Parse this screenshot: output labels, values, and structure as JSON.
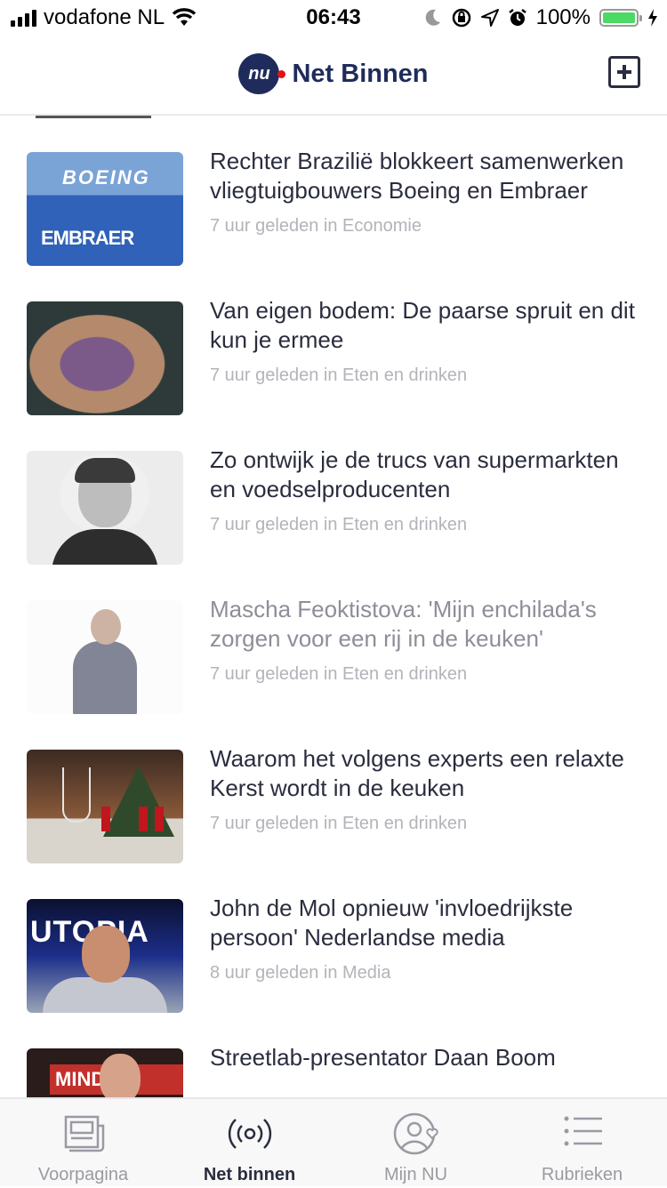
{
  "status_bar": {
    "carrier": "vodafone NL",
    "time": "06:43",
    "battery": "100%",
    "battery_level": 1.0
  },
  "header": {
    "logo_text": "nu",
    "title": "Net Binnen",
    "add_icon": "add-square-icon"
  },
  "articles": [
    {
      "title": "Rechter Brazilië blokkeert samenwerken vliegtuigbouwers Boeing en Embraer",
      "meta": "7 uur geleden in Economie",
      "read": false,
      "thumb_text_1": "BOEING",
      "thumb_text_2": "EMBRAER"
    },
    {
      "title": "Van eigen bodem: De paarse spruit en dit kun je ermee",
      "meta": "7 uur geleden in Eten en drinken",
      "read": false
    },
    {
      "title": "Zo ontwijk je de trucs van supermarkten en voedselproducenten",
      "meta": "7 uur geleden in Eten en drinken",
      "read": false
    },
    {
      "title": "Mascha Feoktistova: 'Mijn enchilada's zorgen voor een rij in de keuken'",
      "meta": "7 uur geleden in Eten en drinken",
      "read": true
    },
    {
      "title": "Waarom het volgens experts een relaxte Kerst wordt in de keuken",
      "meta": "7 uur geleden in Eten en drinken",
      "read": false
    },
    {
      "title": "John de Mol opnieuw 'invloedrijkste persoon' Nederlandse media",
      "meta": "8 uur geleden in Media",
      "read": false,
      "thumb_text_1": "UTOPIA"
    },
    {
      "title": "Streetlab-presentator Daan Boom ",
      "meta": "",
      "read": false,
      "thumb_text_1": "MINDF"
    }
  ],
  "tabs": [
    {
      "label": "Voorpagina",
      "icon": "newspaper-icon",
      "active": false
    },
    {
      "label": "Net binnen",
      "icon": "broadcast-icon",
      "active": true
    },
    {
      "label": "Mijn NU",
      "icon": "user-heart-icon",
      "active": false
    },
    {
      "label": "Rubrieken",
      "icon": "list-icon",
      "active": false
    }
  ]
}
